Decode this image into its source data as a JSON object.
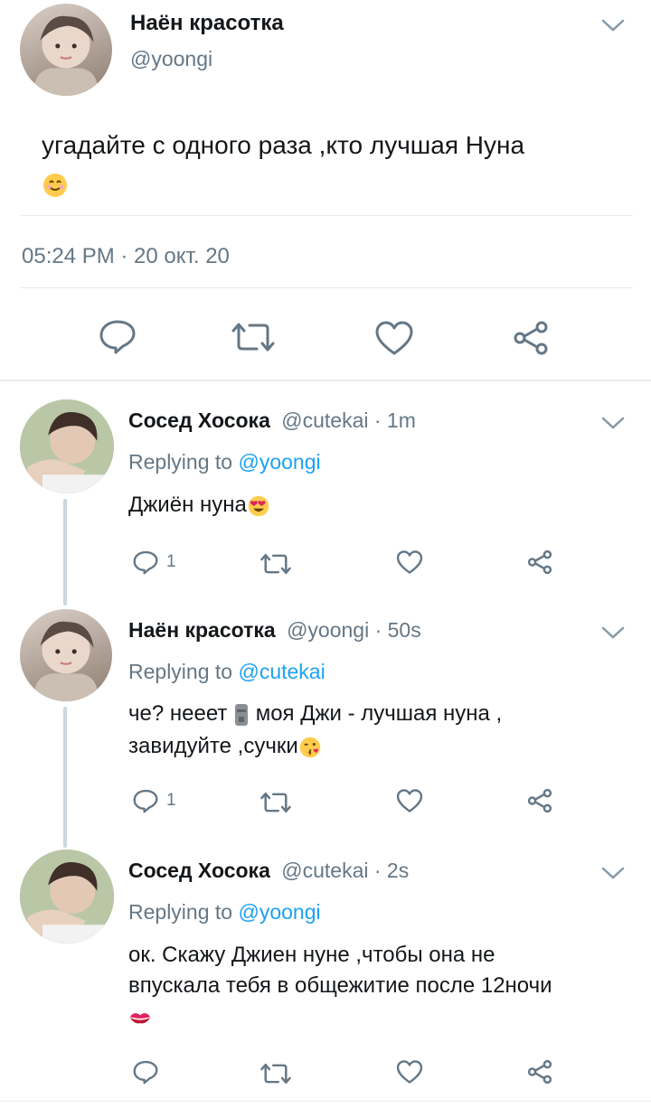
{
  "main_tweet": {
    "author_name": "Наён красотка",
    "author_handle": "@yoongi",
    "text": "угадайте с одного раза ,кто лучшая Нуна",
    "timestamp": "05:24 PM · 20 окт. 20"
  },
  "replies": [
    {
      "author_name": "Сосед Хосока",
      "meta": "@cutekai · 1m",
      "replying_prefix": "Replying to",
      "replying_to": "@yoongi",
      "text": "Джиён нуна",
      "reply_count": "1"
    },
    {
      "author_name": "Наён красотка",
      "meta": "@yoongi · 50s",
      "replying_prefix": "Replying to",
      "replying_to": "@cutekai",
      "text_line1": "че? нееет",
      "text_line1b": "моя Джи - лучшая нуна ,",
      "text_line2": "завидуйте ,сучки",
      "reply_count": "1"
    },
    {
      "author_name": "Сосед Хосока",
      "meta": "@cutekai · 2s",
      "replying_prefix": "Replying to",
      "replying_to": "@yoongi",
      "text_line1": "ок. Скажу Джиен нуне ,чтобы она не",
      "text_line2": "впускала тебя в общежитие после 12ночи"
    }
  ],
  "icons": [
    "chevron-down-icon",
    "reply-icon",
    "retweet-icon",
    "like-icon",
    "share-icon"
  ],
  "colors": {
    "accent": "#1da1f2",
    "muted": "#657786",
    "divider": "#e6ecf0"
  }
}
